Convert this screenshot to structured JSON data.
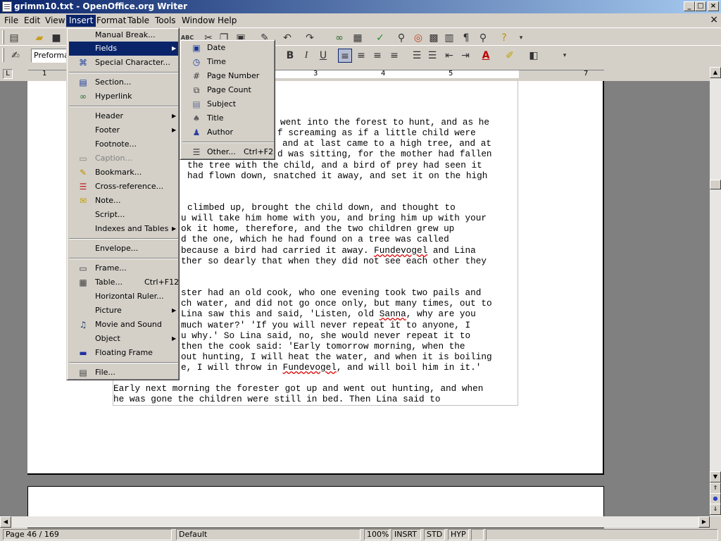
{
  "window": {
    "title": "grimm10.txt - OpenOffice.org Writer",
    "buttons": {
      "minimize": "_",
      "maximize": "□",
      "close": "×"
    }
  },
  "menubar": {
    "items": [
      "File",
      "Edit",
      "View",
      "Insert",
      "Format",
      "Table",
      "Tools",
      "Window",
      "Help"
    ],
    "active": "Insert",
    "close_doc": "×"
  },
  "toolbar": {
    "paragraph_style": "Preformat",
    "bold": "B",
    "italic": "I",
    "underline": "U"
  },
  "ruler": {
    "numbers": [
      "1",
      "3",
      "4",
      "5",
      "7"
    ]
  },
  "insert_menu": {
    "items": [
      {
        "label": "Manual Break...",
        "icon": "none"
      },
      {
        "label": "Fields",
        "icon": "none",
        "submenu": true,
        "selected": true
      },
      {
        "label": "Special Character...",
        "icon": "special-character-icon"
      },
      {
        "label": "Section...",
        "icon": "section-icon"
      },
      {
        "label": "Hyperlink",
        "icon": "hyperlink-icon"
      },
      {
        "label": "Header",
        "icon": "none",
        "submenu": true
      },
      {
        "label": "Footer",
        "icon": "none",
        "submenu": true
      },
      {
        "label": "Footnote...",
        "icon": "none"
      },
      {
        "label": "Caption...",
        "icon": "caption-icon",
        "disabled": true
      },
      {
        "label": "Bookmark...",
        "icon": "bookmark-icon"
      },
      {
        "label": "Cross-reference...",
        "icon": "cross-reference-icon"
      },
      {
        "label": "Note...",
        "icon": "note-icon"
      },
      {
        "label": "Script...",
        "icon": "none"
      },
      {
        "label": "Indexes and Tables",
        "icon": "none",
        "submenu": true
      },
      {
        "label": "Envelope...",
        "icon": "none"
      },
      {
        "label": "Frame...",
        "icon": "frame-icon"
      },
      {
        "label": "Table...",
        "icon": "table-icon",
        "shortcut": "Ctrl+F12"
      },
      {
        "label": "Horizontal Ruler...",
        "icon": "none"
      },
      {
        "label": "Picture",
        "icon": "none",
        "submenu": true
      },
      {
        "label": "Movie and Sound",
        "icon": "movie-icon"
      },
      {
        "label": "Object",
        "icon": "none",
        "submenu": true
      },
      {
        "label": "Floating Frame",
        "icon": "floating-frame-icon"
      },
      {
        "label": "File...",
        "icon": "file-icon"
      }
    ]
  },
  "fields_menu": {
    "items": [
      {
        "label": "Date",
        "icon": "date-icon"
      },
      {
        "label": "Time",
        "icon": "time-icon"
      },
      {
        "label": "Page Number",
        "icon": "page-number-icon"
      },
      {
        "label": "Page Count",
        "icon": "page-count-icon"
      },
      {
        "label": "Subject",
        "icon": "subject-icon"
      },
      {
        "label": "Title",
        "icon": "title-icon"
      },
      {
        "label": "Author",
        "icon": "author-icon"
      },
      {
        "label": "Other...",
        "icon": "other-fields-icon",
        "shortcut": "Ctrl+F2"
      }
    ]
  },
  "document": {
    "lines": [
      "went into the forest to hunt, and as he",
      "f screaming as if a little child were",
      "and at last came to a high tree, and at",
      "d was sitting, for the mother had fallen",
      "the tree with the child, and a bird of prey had seen it",
      "had flown down, snatched it away, and set it on the high",
      "",
      "",
      "climbed up, brought the child down, and thought to",
      "u will take him home with you, and bring him up with your",
      "ok it home, therefore, and the two children grew up",
      "d the one, which he had found on a tree was called",
      "because a bird had carried it away. Fundevogel and Lina",
      "ther so dearly that when they did not see each other they",
      "",
      "",
      "ster had an old cook, who one evening took two pails and",
      "ch water, and did not go once only, but many times, out to",
      "Lina saw this and said, 'Listen, old Sanna, why are you",
      "much water?' 'If you will never repeat it to anyone, I",
      "u why.' So Lina said, no, she would never repeat it to",
      "then the cook said: 'Early tomorrow morning, when the",
      "out hunting, I will heat the water, and when it is boiling",
      "e, I will throw in Fundevogel, and will boil him in it.'",
      "",
      "Early next morning the forester got up and went out hunting, and when",
      "he was gone the children were still in bed. Then Lina said to"
    ]
  },
  "statusbar": {
    "page": "Page 46 / 169",
    "style": "Default",
    "zoom": "100%",
    "insert_mode": "INSRT",
    "selection_mode": "STD",
    "hyphenation": "HYP"
  }
}
